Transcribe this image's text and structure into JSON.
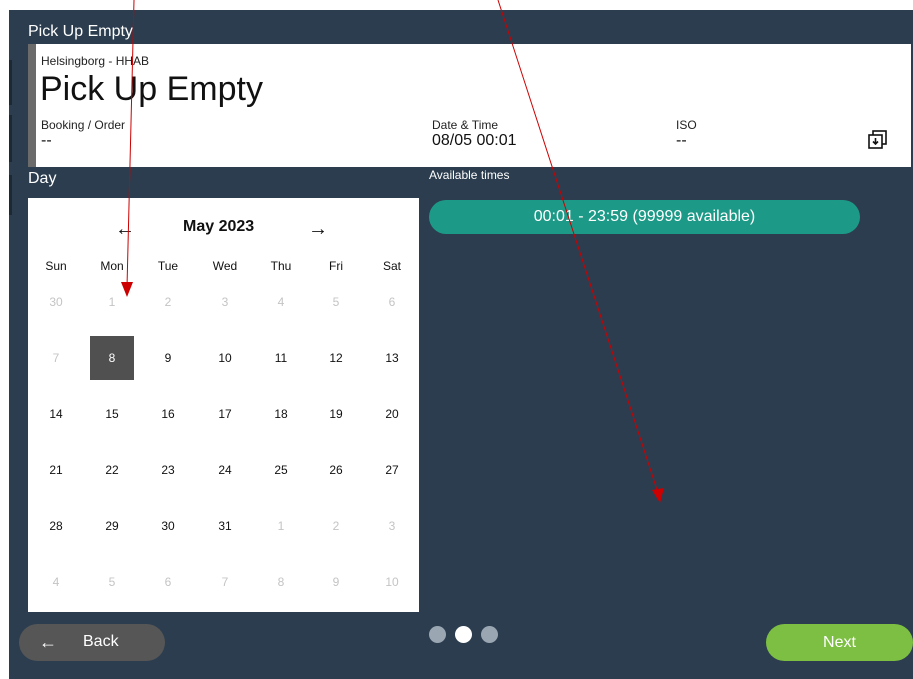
{
  "panel": {
    "title": "Pick Up Empty"
  },
  "card": {
    "location": "Helsingborg - HHAB",
    "heading": "Pick Up Empty",
    "booking_label": "Booking / Order",
    "booking_value": "--",
    "datetime_label": "Date & Time",
    "datetime_value": "08/05 00:01",
    "iso_label": "ISO",
    "iso_value": "--",
    "icon": "download-icon"
  },
  "day_label": "Day",
  "available_label": "Available times",
  "calendar": {
    "prev_arrow": "←",
    "next_arrow": "→",
    "month": "May 2023",
    "weekdays": [
      "Sun",
      "Mon",
      "Tue",
      "Wed",
      "Thu",
      "Fri",
      "Sat"
    ],
    "weeks": [
      [
        {
          "d": "30",
          "muted": true
        },
        {
          "d": "1",
          "muted": true
        },
        {
          "d": "2",
          "muted": true
        },
        {
          "d": "3",
          "muted": true
        },
        {
          "d": "4",
          "muted": true
        },
        {
          "d": "5",
          "muted": true
        },
        {
          "d": "6",
          "muted": true
        }
      ],
      [
        {
          "d": "7",
          "muted": true
        },
        {
          "d": "8",
          "selected": true
        },
        {
          "d": "9"
        },
        {
          "d": "10"
        },
        {
          "d": "11"
        },
        {
          "d": "12"
        },
        {
          "d": "13"
        }
      ],
      [
        {
          "d": "14"
        },
        {
          "d": "15"
        },
        {
          "d": "16"
        },
        {
          "d": "17"
        },
        {
          "d": "18"
        },
        {
          "d": "19"
        },
        {
          "d": "20"
        }
      ],
      [
        {
          "d": "21"
        },
        {
          "d": "22"
        },
        {
          "d": "23"
        },
        {
          "d": "24"
        },
        {
          "d": "25"
        },
        {
          "d": "26"
        },
        {
          "d": "27"
        }
      ],
      [
        {
          "d": "28"
        },
        {
          "d": "29"
        },
        {
          "d": "30"
        },
        {
          "d": "31"
        },
        {
          "d": "1",
          "muted": true
        },
        {
          "d": "2",
          "muted": true
        },
        {
          "d": "3",
          "muted": true
        }
      ],
      [
        {
          "d": "4",
          "muted": true
        },
        {
          "d": "5",
          "muted": true
        },
        {
          "d": "6",
          "muted": true
        },
        {
          "d": "7",
          "muted": true
        },
        {
          "d": "8",
          "muted": true
        },
        {
          "d": "9",
          "muted": true
        },
        {
          "d": "10",
          "muted": true
        }
      ]
    ]
  },
  "timeslot": {
    "label": "00:01 - 23:59 (99999 available)"
  },
  "footer": {
    "back_arrow": "←",
    "back_label": "Back",
    "next_label": "Next",
    "steps": [
      {
        "active": false
      },
      {
        "active": true
      },
      {
        "active": false
      }
    ]
  },
  "colors": {
    "background": "#2b3d4f",
    "timeslot": "#1d9a87",
    "next_button": "#7dbf42",
    "back_button": "#565656",
    "selected_day": "#505050",
    "annotation": "#cc0000"
  }
}
